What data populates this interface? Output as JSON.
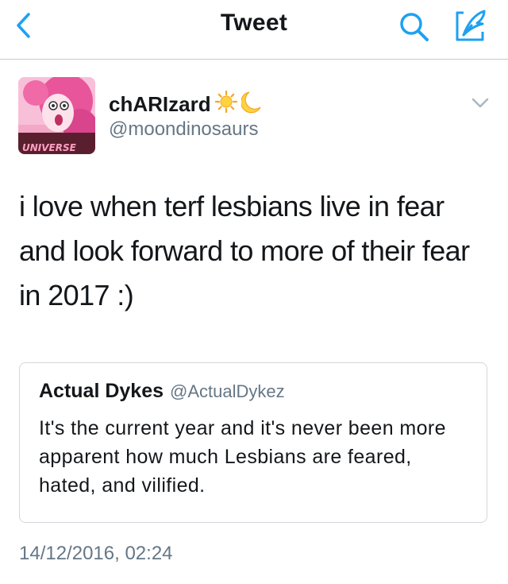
{
  "header": {
    "title": "Tweet",
    "back_icon": "chevron-left-icon",
    "search_icon": "search-icon",
    "compose_icon": "compose-feather-icon",
    "accent_color": "#1da1f2"
  },
  "tweet": {
    "author": {
      "display_name": "chARIzard",
      "name_emojis": [
        "sun-emoji",
        "crescent-moon-emoji"
      ],
      "handle": "@moondinosaurs",
      "avatar_caption": "UNIVERSE"
    },
    "text": "i love when terf lesbians live in fear and look forward to more of their fear in 2017 :)",
    "quoted": {
      "display_name": "Actual Dykes",
      "handle": "@ActualDykez",
      "text": "It's the current year and it's never been more apparent how much Lesbians are feared, hated, and vilified."
    },
    "timestamp": "14/12/2016, 02:24"
  },
  "colors": {
    "text_primary": "#14171a",
    "text_secondary": "#657786",
    "divider": "#c8c8cc",
    "card_border": "#d3d7dc"
  }
}
